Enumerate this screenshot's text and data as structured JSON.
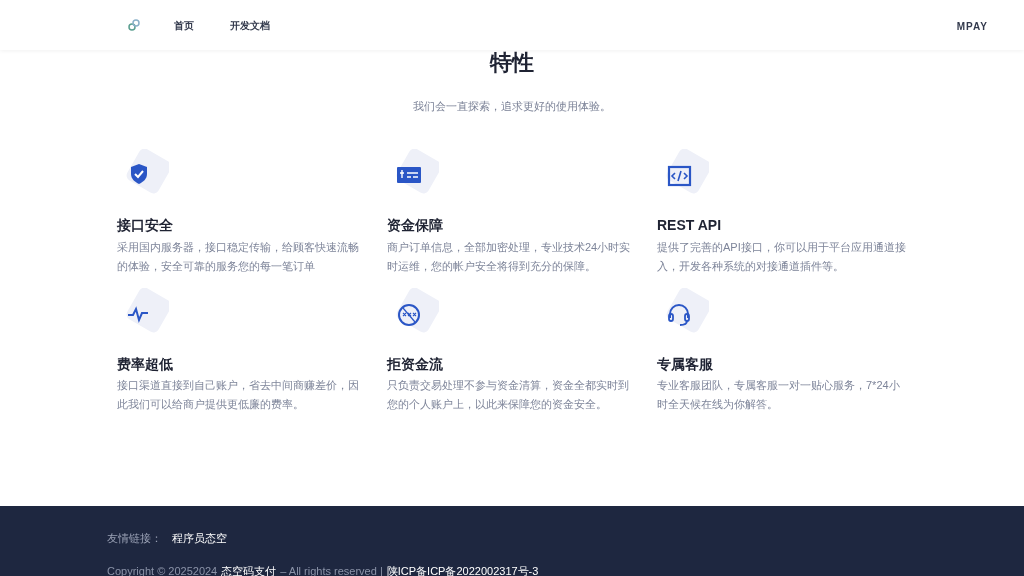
{
  "navbar": {
    "links": [
      {
        "label": "首页"
      },
      {
        "label": "开发文档"
      }
    ],
    "brand": "MPAY"
  },
  "section": {
    "title": "特性",
    "subtitle": "我们会一直探索，追求更好的使用体验。"
  },
  "features": [
    {
      "kind": "shield",
      "title": "接口安全",
      "text": "采用国内服务器，接口稳定传输，给顾客快速流畅的体验，安全可靠的服务您的每一笔订单"
    },
    {
      "kind": "money",
      "title": "资金保障",
      "text": "商户订单信息，全部加密处理，专业技术24小时实时运维，您的帐户安全将得到充分的保障。"
    },
    {
      "kind": "code",
      "title": "REST API",
      "text": "提供了完善的API接口，你可以用于平台应用通道接入，开发各种系统的对接通道插件等。"
    },
    {
      "kind": "pulse",
      "title": "费率超低",
      "text": "接口渠道直接到自己账户，省去中间商赚差价，因此我们可以给商户提供更低廉的费率。"
    },
    {
      "kind": "block",
      "title": "拒资金流",
      "text": "只负责交易处理不参与资金清算，资金全都实时到您的个人账户上，以此来保障您的资金安全。"
    },
    {
      "kind": "headset",
      "title": "专属客服",
      "text": "专业客服团队，专属客服一对一贴心服务，7*24小时全天候在线为你解答。"
    }
  ],
  "footer": {
    "links_label": "友情链接：",
    "links": [
      "程序员态空"
    ],
    "copyright": "Copyright © 20252024",
    "site_link": "态空码支付",
    "rights": "– All rights reserved |",
    "icp_link": "陕ICP备ICP备2022002317号-3"
  }
}
